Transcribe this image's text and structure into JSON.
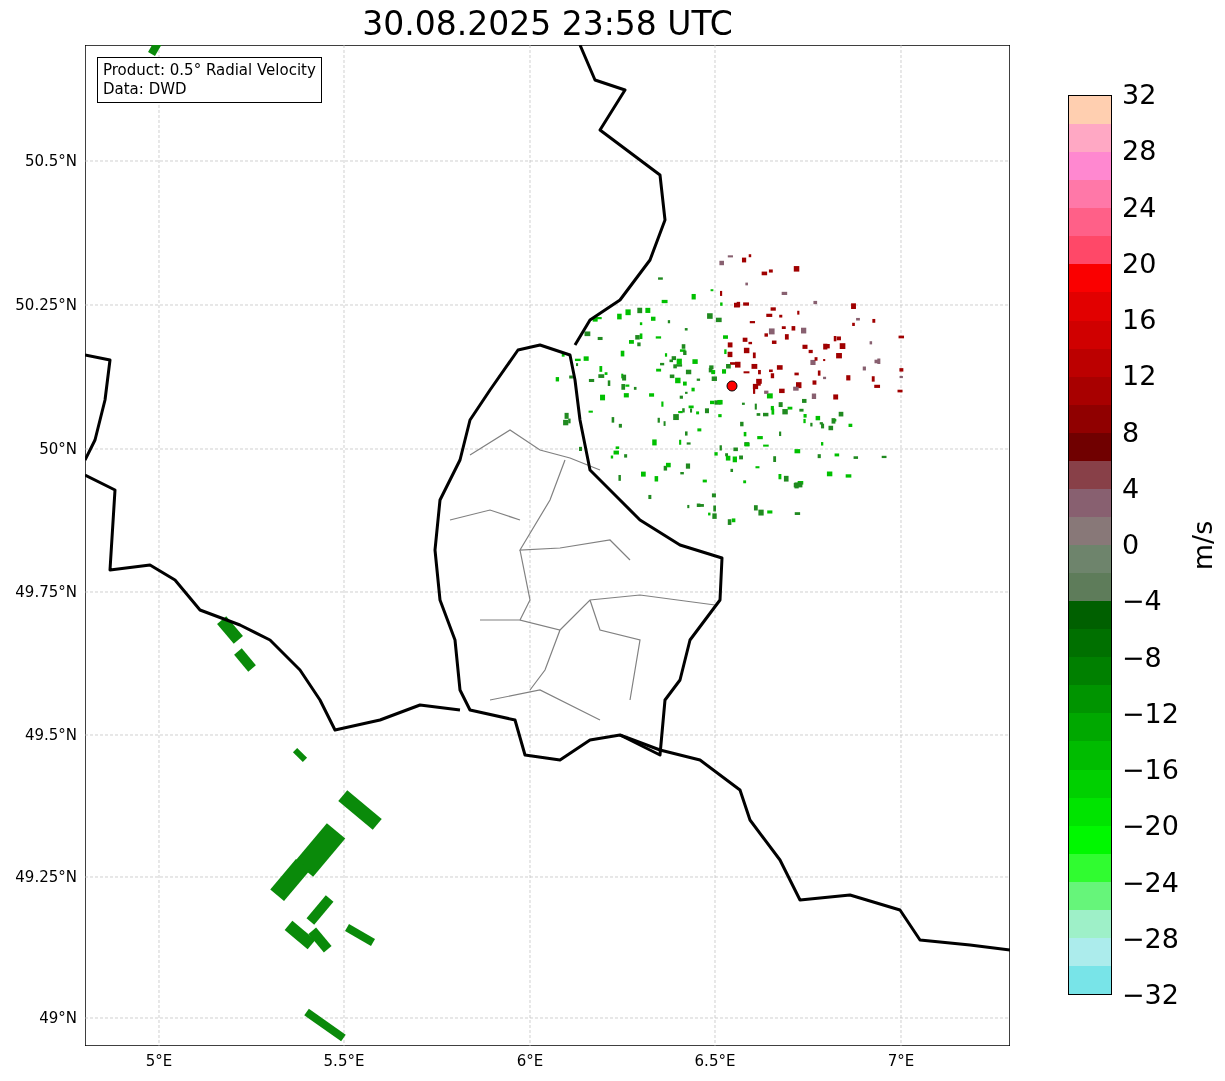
{
  "title": "30.08.2025 23:58 UTC",
  "map": {
    "info_lines": [
      "Product: 0.5° Radial Velocity",
      "Data: DWD"
    ],
    "lat_labels": [
      "50.5°N",
      "50.25°N",
      "50°N",
      "49.75°N",
      "49.5°N",
      "49.25°N",
      "49°N"
    ],
    "lon_labels": [
      "5°E",
      "5.5°E",
      "6°E",
      "6.5°E",
      "7°E"
    ]
  },
  "colorbar": {
    "label": "m/s",
    "ticks": [
      "32",
      "28",
      "24",
      "20",
      "16",
      "12",
      "8",
      "4",
      "0",
      "−4",
      "−8",
      "−12",
      "−16",
      "−20",
      "−24",
      "−28",
      "−32"
    ],
    "segments": [
      {
        "color": "#ffcfb0"
      },
      {
        "color": "#ffa8c4"
      },
      {
        "color": "#ff88d0"
      },
      {
        "color": "#ff78a8"
      },
      {
        "color": "#ff6088"
      },
      {
        "color": "#ff4868"
      },
      {
        "color": "#fa0000"
      },
      {
        "color": "#e20000"
      },
      {
        "color": "#d00000"
      },
      {
        "color": "#bc0000"
      },
      {
        "color": "#a80000"
      },
      {
        "color": "#900000"
      },
      {
        "color": "#700000"
      },
      {
        "color": "#884048"
      },
      {
        "color": "#886070"
      },
      {
        "color": "#887878"
      },
      {
        "color": "#6e846c"
      },
      {
        "color": "#5e7c5a"
      },
      {
        "color": "#006000"
      },
      {
        "color": "#007000"
      },
      {
        "color": "#008000"
      },
      {
        "color": "#009400"
      },
      {
        "color": "#00a800"
      },
      {
        "color": "#00bc00"
      },
      {
        "color": "#00d000"
      },
      {
        "color": "#00e400"
      },
      {
        "color": "#00f800"
      },
      {
        "color": "#30fc30"
      },
      {
        "color": "#66f57a"
      },
      {
        "color": "#9ef0c8"
      },
      {
        "color": "#acecec"
      },
      {
        "color": "#78e4e8"
      }
    ]
  }
}
